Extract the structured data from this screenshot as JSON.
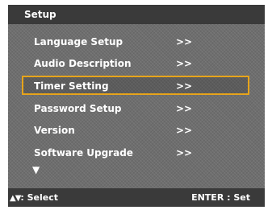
{
  "window": {
    "title": "Setup"
  },
  "menu": {
    "items": [
      {
        "label": "Language Setup",
        "arrow": ">>"
      },
      {
        "label": "Audio Description",
        "arrow": ">>"
      },
      {
        "label": "Timer Setting",
        "arrow": ">>"
      },
      {
        "label": "Password Setup",
        "arrow": ">>"
      },
      {
        "label": "Version",
        "arrow": ">>"
      },
      {
        "label": "Software Upgrade",
        "arrow": ">>"
      }
    ],
    "selected_item": "Timer Setting",
    "more_indicator": "▼",
    "more_icon": "triangle-down-icon"
  },
  "status": {
    "nav_icon": "up-down-arrows-icon",
    "nav_glyph": "▲▼",
    "select_label": ": Select",
    "enter_label": "ENTER : Set"
  },
  "colors": {
    "highlight_border": "#e7a41a",
    "bar_background": "#3a3a3a",
    "panel_background": "#6e6e6e",
    "text": "#ffffff"
  }
}
